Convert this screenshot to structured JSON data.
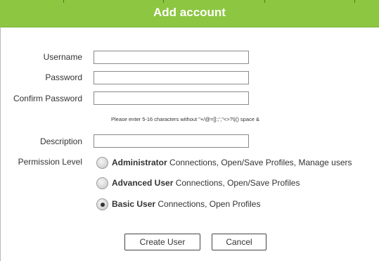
{
  "dialog": {
    "title": "Add account"
  },
  "form": {
    "username_label": "Username",
    "username_value": "",
    "password_label": "Password",
    "password_value": "",
    "confirm_password_label": "Confirm Password",
    "confirm_password_value": "",
    "password_hint": "Please enter 5-16 characters without \"+/@=[]:;',\"<>?\\|() space &",
    "description_label": "Description",
    "description_value": "",
    "permission_label": "Permission Level"
  },
  "permissions": [
    {
      "name": "Administrator",
      "description": "Connections, Open/Save Profiles, Manage users",
      "selected": false
    },
    {
      "name": "Advanced User",
      "description": "Connections, Open/Save Profiles",
      "selected": false
    },
    {
      "name": "Basic User",
      "description": "Connections, Open Profiles",
      "selected": true
    }
  ],
  "buttons": {
    "create_label": "Create User",
    "cancel_label": "Cancel"
  },
  "colors": {
    "header": "#8dc641",
    "header_text": "#ffffff"
  }
}
